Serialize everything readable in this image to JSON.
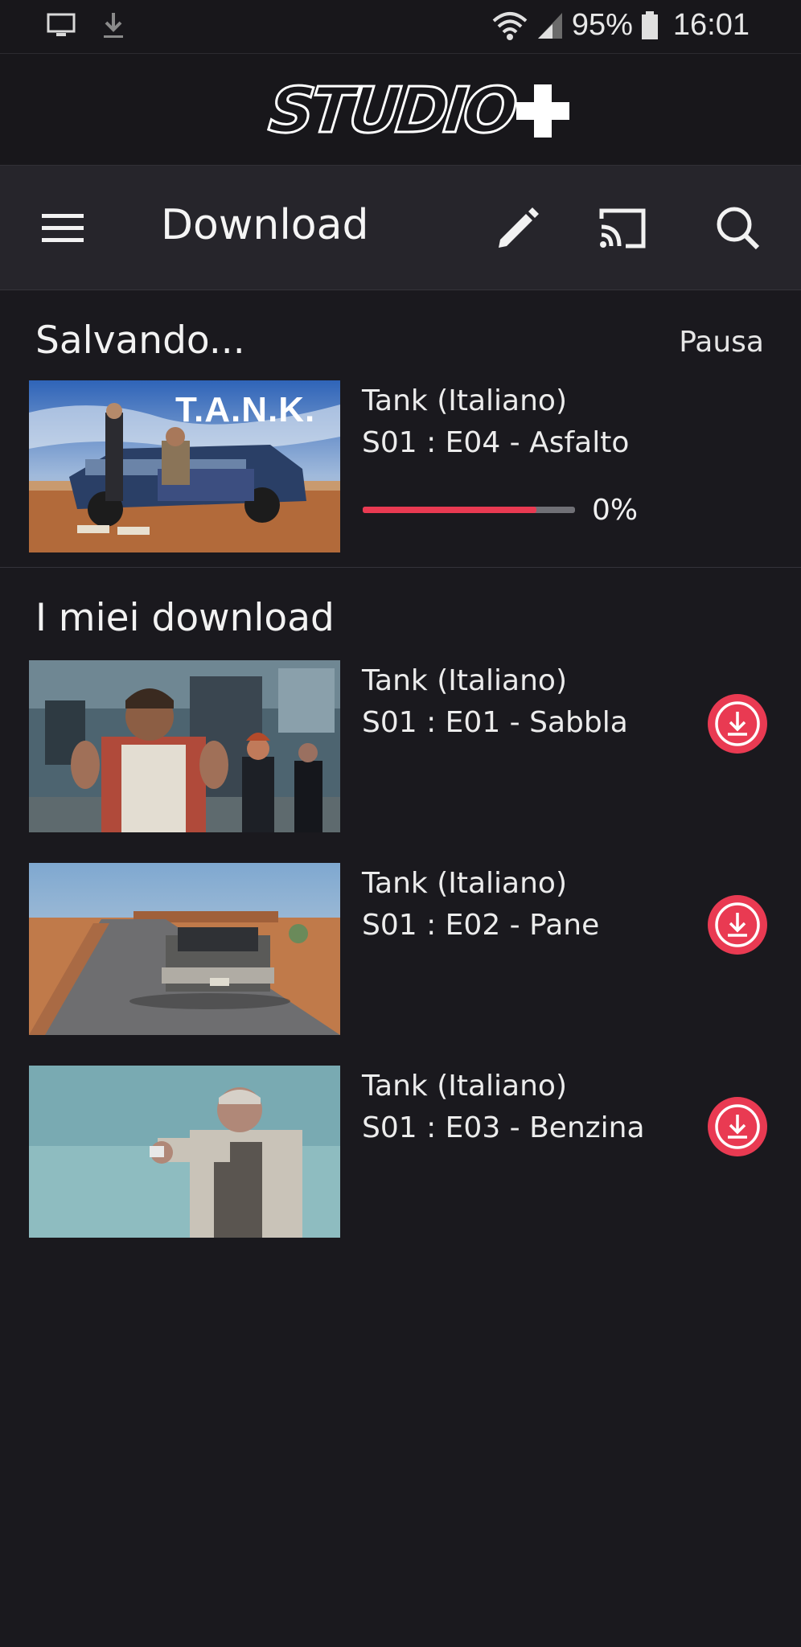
{
  "status_bar": {
    "battery": "95%",
    "time": "16:01",
    "icons": [
      "monitor-icon",
      "download-icon",
      "wifi-icon",
      "signal-icon",
      "battery-icon"
    ]
  },
  "app": {
    "logo_text": "STUDIO"
  },
  "toolbar": {
    "title": "Download",
    "icons": [
      "menu-icon",
      "edit-icon",
      "cast-icon",
      "search-icon"
    ]
  },
  "saving": {
    "heading": "Salvando...",
    "pause_label": "Pausa",
    "item": {
      "title": "Tank  (Italiano)",
      "episode": "S01 : E04 - Asfalto",
      "progress_label": "0%",
      "progress_bar_fill": 0.82,
      "thumb_text": "T.A.N.K."
    }
  },
  "downloads": {
    "heading": "I miei download",
    "items": [
      {
        "title": "Tank  (Italiano)",
        "episode": "S01 : E01 - Sabbla"
      },
      {
        "title": "Tank  (Italiano)",
        "episode": "S01 : E02 - Pane"
      },
      {
        "title": "Tank  (Italiano)",
        "episode": "S01 : E03 - Benzina"
      }
    ]
  },
  "colors": {
    "background": "#1a191e",
    "toolbar": "#26252b",
    "accent": "#e93a52"
  }
}
